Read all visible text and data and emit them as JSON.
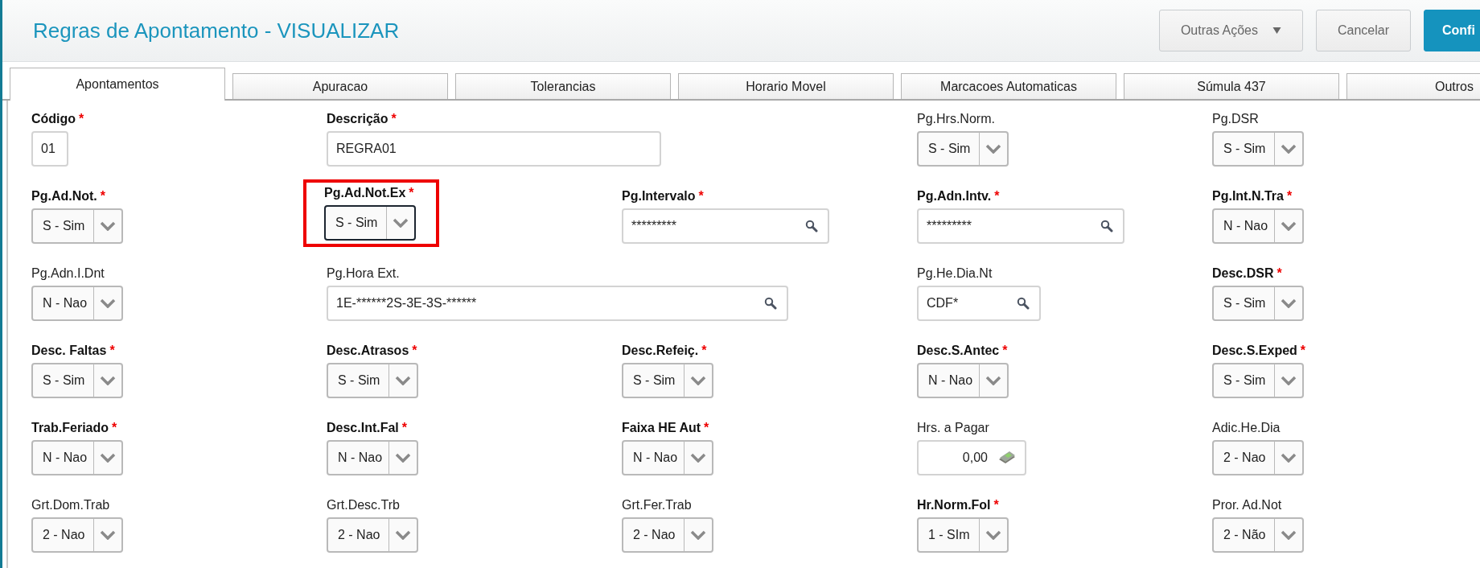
{
  "header": {
    "title": "Regras de Apontamento - VISUALIZAR",
    "buttons": [
      {
        "label": "Outras Ações",
        "kind": "menu"
      },
      {
        "label": "Cancelar",
        "kind": "plain"
      },
      {
        "label": "Confi",
        "kind": "primary"
      }
    ]
  },
  "tabs": [
    {
      "label": "Apontamentos",
      "selected": true
    },
    {
      "label": "Apuracao",
      "selected": false
    },
    {
      "label": "Tolerancias",
      "selected": false
    },
    {
      "label": "Horario Movel",
      "selected": false
    },
    {
      "label": "Marcacoes Automaticas",
      "selected": false
    },
    {
      "label": "Súmula 437",
      "selected": false
    },
    {
      "label": "Outros",
      "selected": false
    }
  ],
  "rows": [
    [
      {
        "label": "Código",
        "required_mark": "*",
        "kind": "code",
        "value": "01",
        "highlighted": false
      },
      {
        "label": "Descrição",
        "required_mark": "*",
        "kind": "text",
        "value": "REGRA01",
        "highlighted": false
      },
      {
        "label": "Pg.Hrs.Norm.",
        "kind": "select",
        "value": "S - Sim",
        "highlighted": false
      },
      {
        "label": "Pg.DSR",
        "kind": "select",
        "value": "S - Sim",
        "highlighted": false
      }
    ],
    [
      {
        "label": "Pg.Ad.Not.",
        "required_mark": "*",
        "kind": "select",
        "value": "S - Sim",
        "highlighted": false
      },
      {
        "label": "Pg.Ad.Not.Ex",
        "required_mark": "*",
        "kind": "select",
        "value": "S - Sim",
        "highlighted": true
      },
      {
        "label": "Pg.Intervalo",
        "required_mark": "*",
        "kind": "lookup",
        "value": "*********",
        "highlighted": false
      },
      {
        "label": "Pg.Adn.Intv.",
        "required_mark": "*",
        "kind": "lookup",
        "value": "*********",
        "highlighted": false
      },
      {
        "label": "Pg.Int.N.Tra",
        "required_mark": "*",
        "kind": "select",
        "value": "N - Nao",
        "highlighted": false
      }
    ],
    [
      {
        "label": "Pg.Adn.I.Dnt",
        "kind": "select",
        "value": "N - Nao",
        "highlighted": false
      },
      {
        "label": "Pg.Hora Ext.",
        "kind": "lookup-wide",
        "value": "1E-******2S-3E-3S-******",
        "highlighted": false
      },
      {
        "label": "Pg.He.Dia.Nt",
        "kind": "lookup-short",
        "value": "CDF*",
        "highlighted": false
      },
      {
        "label": "Desc.DSR",
        "required_mark": "*",
        "kind": "select",
        "value": "S - Sim",
        "highlighted": false
      }
    ],
    [
      {
        "label": "Desc. Faltas",
        "required_mark": "*",
        "kind": "select",
        "value": "S - Sim",
        "highlighted": false
      },
      {
        "label": "Desc.Atrasos",
        "required_mark": "*",
        "kind": "select",
        "value": "S - Sim",
        "highlighted": false
      },
      {
        "label": "Desc.Refeiç.",
        "required_mark": "*",
        "kind": "select",
        "value": "S - Sim",
        "highlighted": false
      },
      {
        "label": "Desc.S.Antec",
        "required_mark": "*",
        "kind": "select",
        "value": "N - Nao",
        "highlighted": false
      },
      {
        "label": "Desc.S.Exped",
        "required_mark": "*",
        "kind": "select",
        "value": "S - Sim",
        "highlighted": false
      }
    ],
    [
      {
        "label": "Trab.Feriado",
        "required_mark": "*",
        "kind": "select",
        "value": "N - Nao",
        "highlighted": false
      },
      {
        "label": "Desc.Int.Fal",
        "required_mark": "*",
        "kind": "select",
        "value": "N - Nao",
        "highlighted": false
      },
      {
        "label": "Faixa HE Aut",
        "required_mark": "*",
        "kind": "select",
        "value": "N - Nao",
        "highlighted": false
      },
      {
        "label": "Hrs. a Pagar",
        "kind": "amount",
        "value": "0,00",
        "highlighted": false
      },
      {
        "label": "Adic.He.Dia",
        "kind": "select",
        "value": "2 - Nao",
        "highlighted": false
      }
    ],
    [
      {
        "label": "Grt.Dom.Trab",
        "kind": "select",
        "value": "2 - Nao",
        "highlighted": false
      },
      {
        "label": "Grt.Desc.Trb",
        "kind": "select",
        "value": "2 - Nao",
        "highlighted": false
      },
      {
        "label": "Grt.Fer.Trab",
        "kind": "select",
        "value": "2 - Nao",
        "highlighted": false
      },
      {
        "label": "Hr.Norm.Fol",
        "required_mark": "*",
        "kind": "select",
        "value": "1 - SIm",
        "highlighted": false
      },
      {
        "label": "Pror. Ad.Not",
        "kind": "select",
        "value": "2 - Não",
        "highlighted": false
      }
    ]
  ]
}
